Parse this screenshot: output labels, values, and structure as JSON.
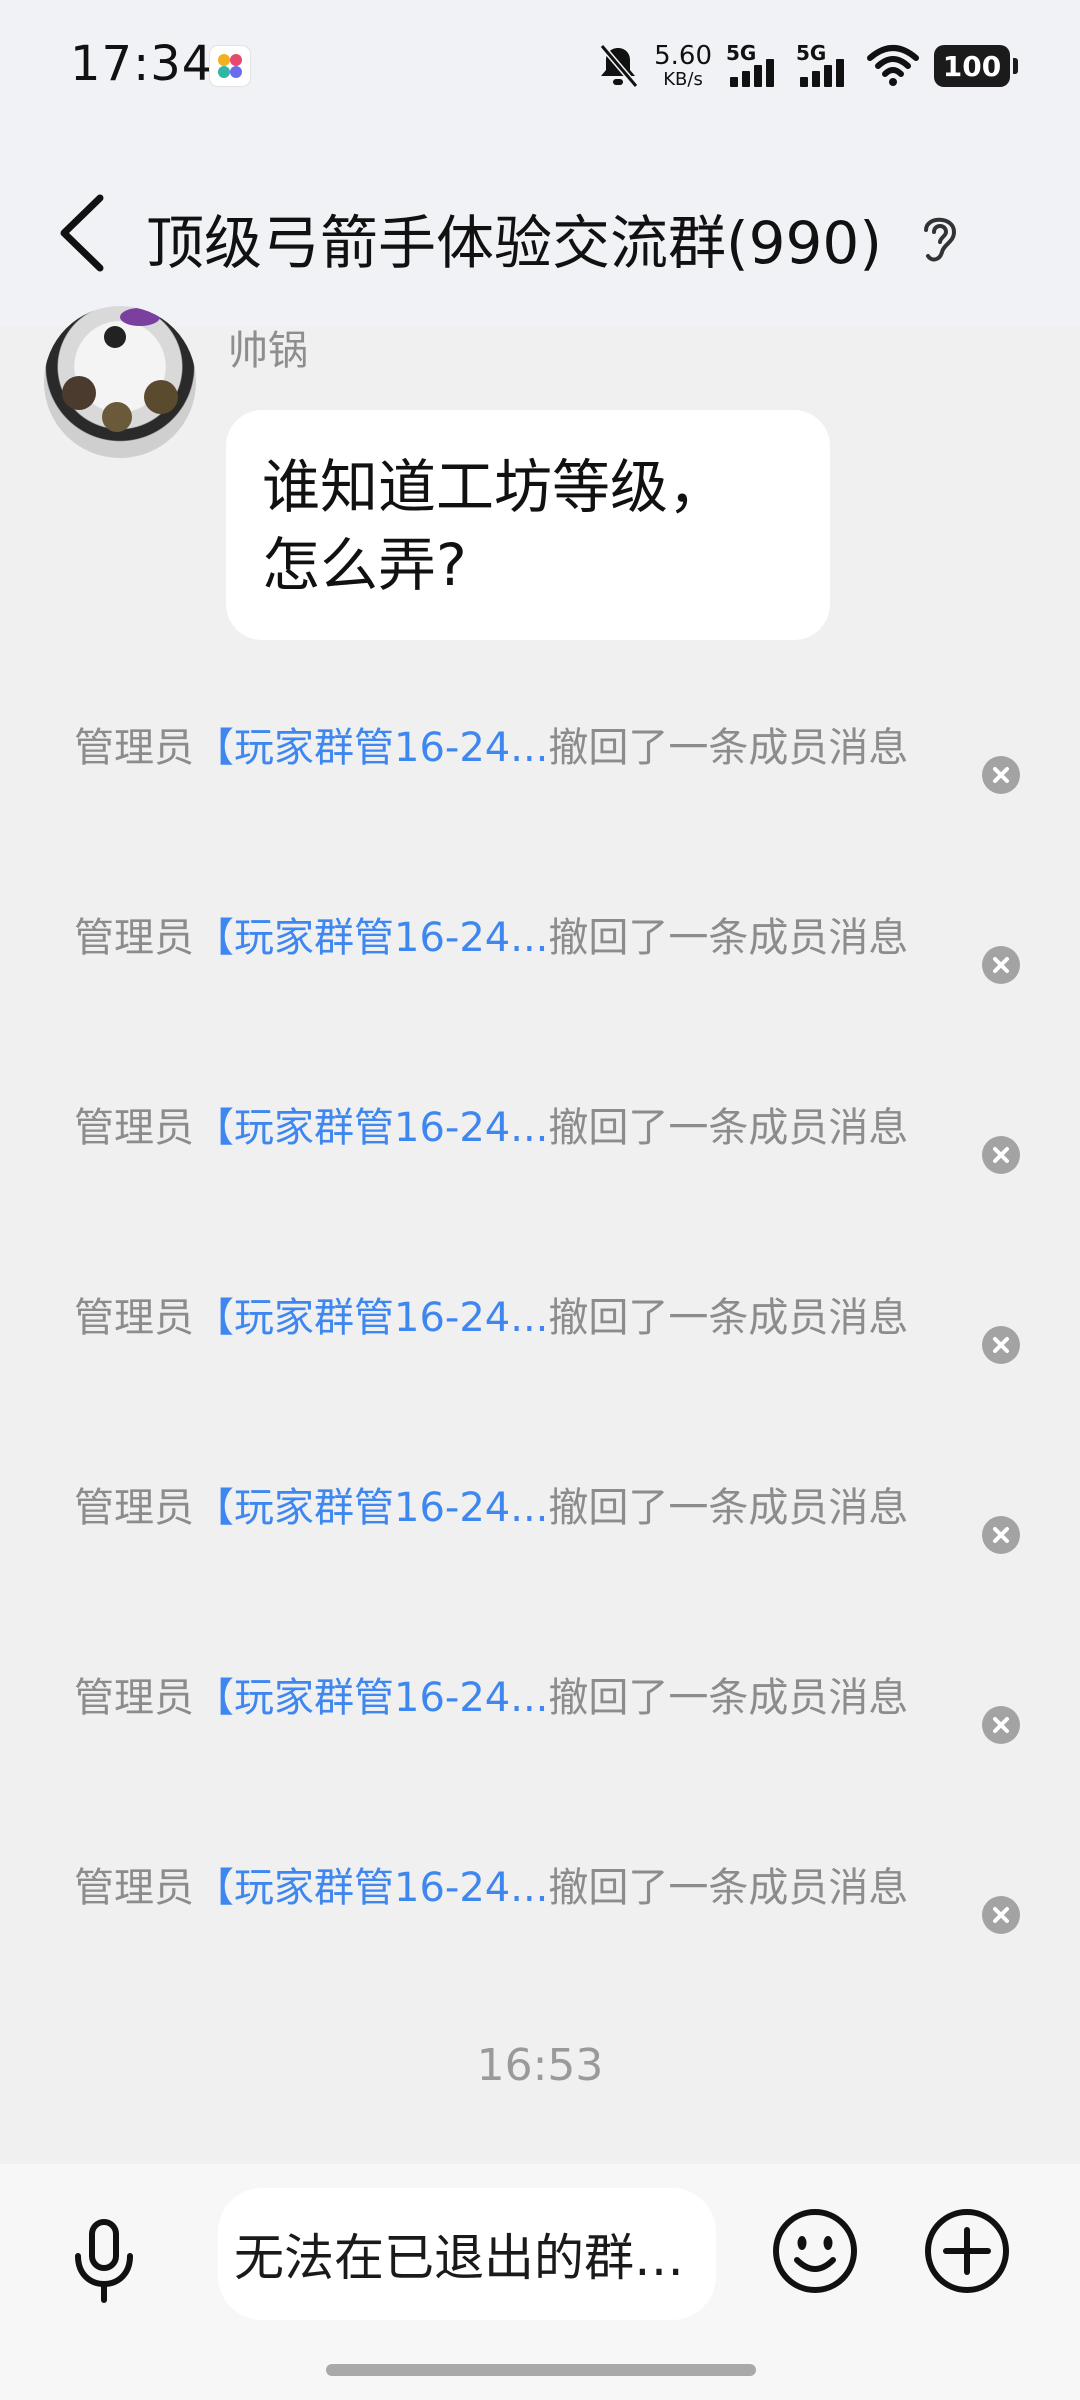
{
  "status_bar": {
    "time": "17:34",
    "net_speed_value": "5.60",
    "net_speed_unit": "KB/s",
    "signal_1_label": "5G",
    "signal_2_label": "5G",
    "battery": "100",
    "icons": [
      "mute-bell-icon",
      "wifi-icon",
      "app-indicator-icon"
    ]
  },
  "header": {
    "title": "顶级弓箭手体验交流群(990)",
    "back_icon": "chevron-left-icon",
    "ear_icon": "ear-icon"
  },
  "messages": {
    "sender_name": "帅锅",
    "bubble_line_1": "谁知道工坊等级，",
    "bubble_line_2": "怎么弄?"
  },
  "recalls": {
    "items": [
      {
        "prefix": "管理员",
        "admin": "【玩家群管16-24...",
        "suffix": "撤回了一条成员消息"
      },
      {
        "prefix": "管理员",
        "admin": "【玩家群管16-24...",
        "suffix": "撤回了一条成员消息"
      },
      {
        "prefix": "管理员",
        "admin": "【玩家群管16-24...",
        "suffix": "撤回了一条成员消息"
      },
      {
        "prefix": "管理员",
        "admin": "【玩家群管16-24...",
        "suffix": "撤回了一条成员消息"
      },
      {
        "prefix": "管理员",
        "admin": "【玩家群管16-24...",
        "suffix": "撤回了一条成员消息"
      },
      {
        "prefix": "管理员",
        "admin": "【玩家群管16-24...",
        "suffix": "撤回了一条成员消息"
      },
      {
        "prefix": "管理员",
        "admin": "【玩家群管16-24...",
        "suffix": "撤回了一条成员消息"
      }
    ]
  },
  "time_divider": "16:53",
  "input_bar": {
    "placeholder": "无法在已退出的群…",
    "icons": [
      "microphone-icon",
      "emoji-icon",
      "plus-circle-icon"
    ]
  },
  "colors": {
    "link_blue": "#3e86f0",
    "system_text": "#8c8c8c",
    "background": "#f0f0f0",
    "bubble": "#ffffff"
  }
}
